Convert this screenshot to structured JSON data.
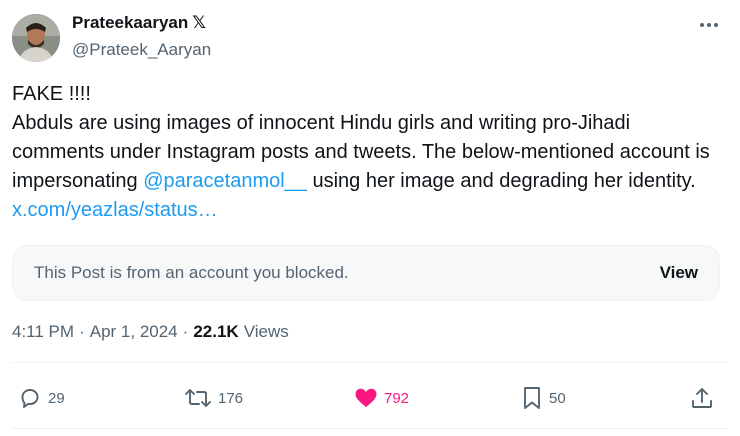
{
  "author": {
    "display_name": "Prateekaaryan",
    "verified_badge": "𝕏",
    "handle": "@Prateek_Aaryan"
  },
  "tweet": {
    "line1": "FAKE !!!!",
    "body_part1": "Abduls are using images of innocent Hindu girls and writing pro-Jihadi comments under Instagram posts and tweets. The below-mentioned account is impersonating ",
    "mention": "@paracetanmol__",
    "body_part2": " using her image and degrading her identity. ",
    "link": "x.com/yeazlas/status…"
  },
  "quoted_card": {
    "message": "This Post is from an account you blocked.",
    "view_label": "View"
  },
  "meta": {
    "time": "4:11 PM",
    "separator": "·",
    "date": "Apr 1, 2024",
    "views_count": "22.1K",
    "views_label": "Views"
  },
  "actions": {
    "replies": "29",
    "reposts": "176",
    "likes": "792",
    "bookmarks": "50"
  },
  "icons": {
    "more": "more-dots-icon",
    "reply": "reply-bubble-icon",
    "repost": "repost-icon",
    "like": "heart-icon",
    "bookmark": "bookmark-icon",
    "share": "share-icon"
  },
  "colors": {
    "accent": "#1d9bf0",
    "like": "#f91880",
    "secondary_text": "#536471"
  }
}
